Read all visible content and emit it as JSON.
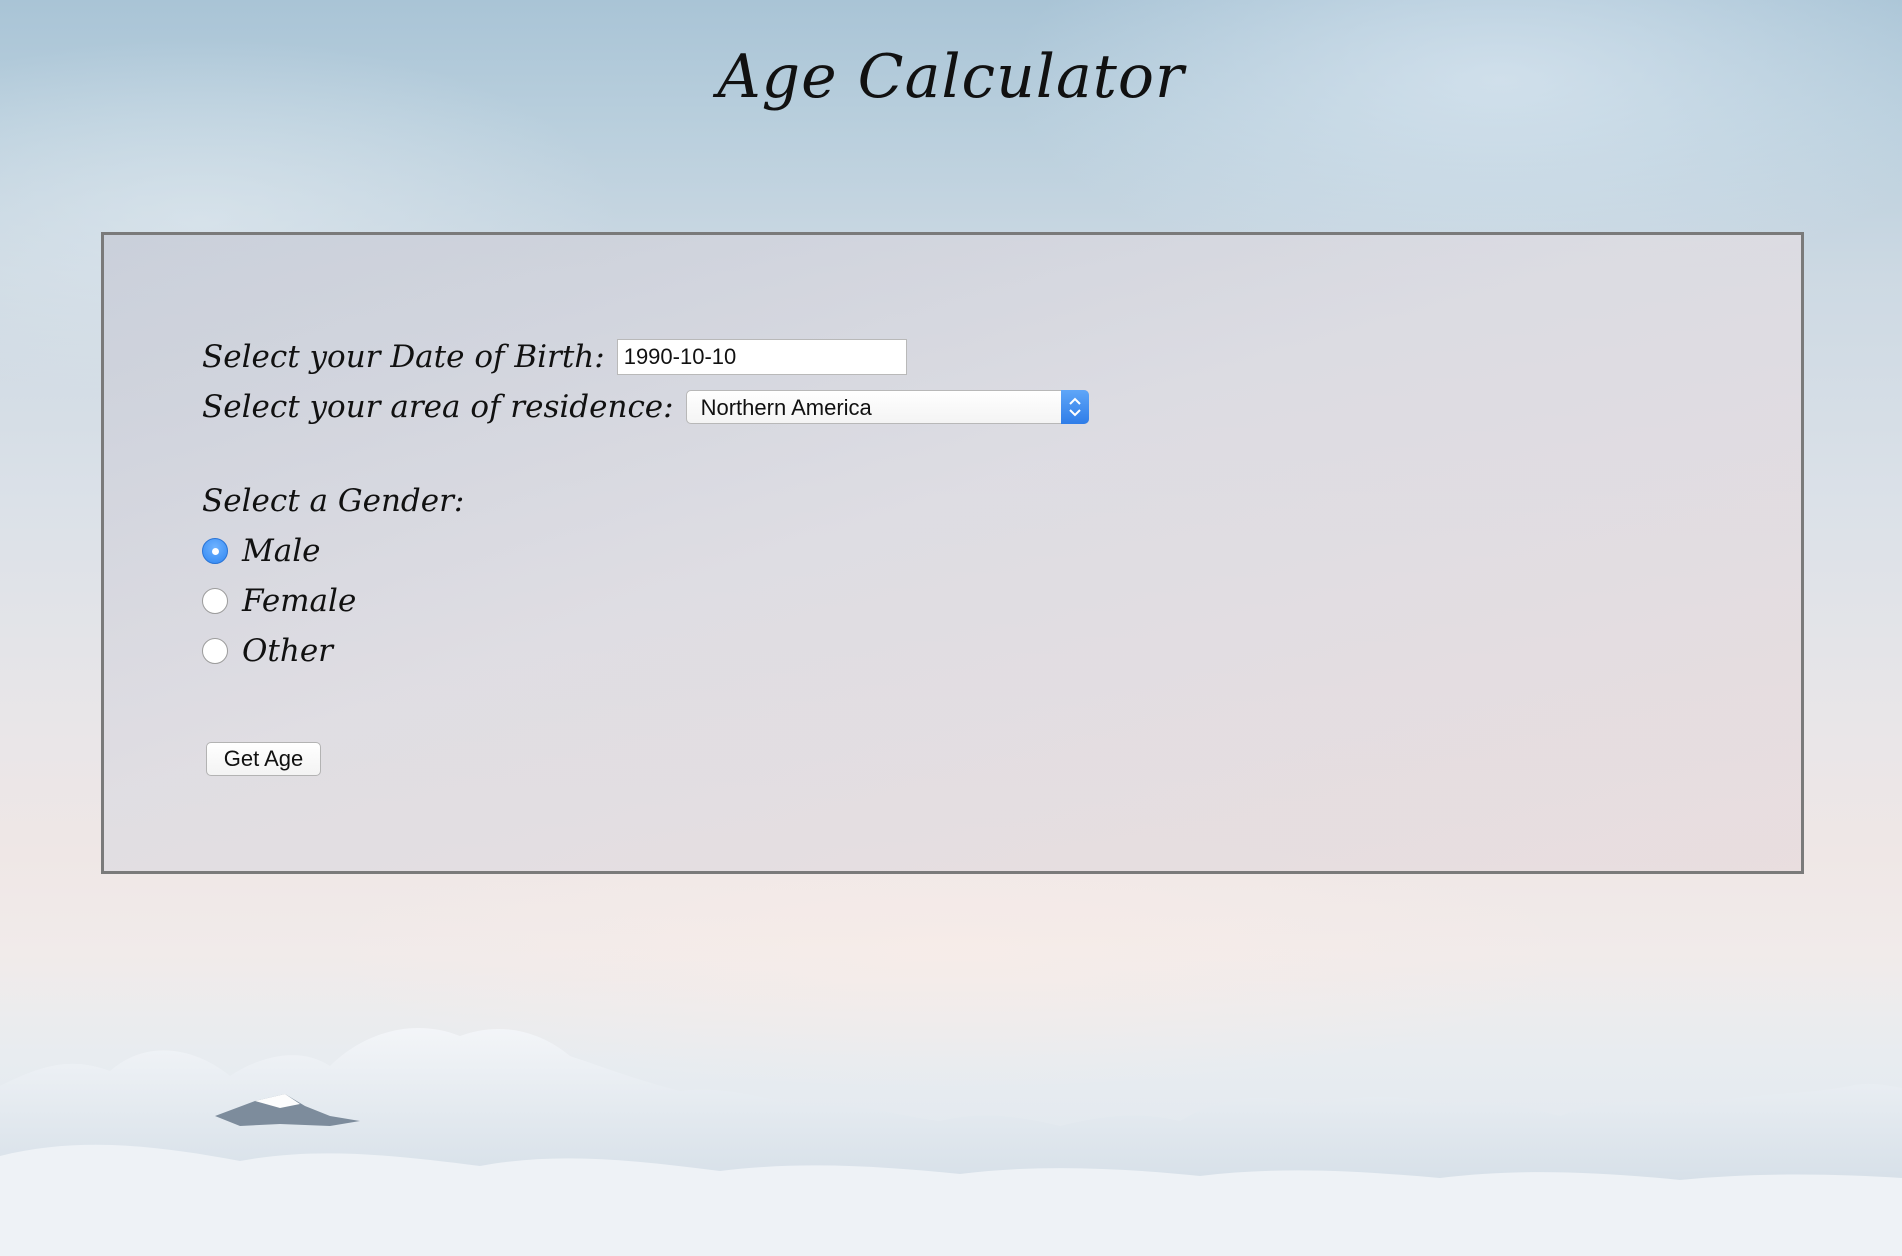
{
  "page": {
    "title": "Age Calculator"
  },
  "form": {
    "dob_label": "Select your Date of Birth:",
    "dob_value": "1990-10-10",
    "residence_label": "Select your area of residence:",
    "residence_value": "Northern America",
    "gender_label": "Select a Gender:",
    "gender_options": [
      {
        "label": "Male",
        "checked": true
      },
      {
        "label": "Female",
        "checked": false
      },
      {
        "label": "Other",
        "checked": false
      }
    ],
    "submit_label": "Get Age"
  },
  "colors": {
    "accent": "#2f86f2",
    "panel_border": "#7a7a7a",
    "text": "#111111"
  },
  "icons": {
    "select_arrows": "chevron-up-down-icon"
  }
}
